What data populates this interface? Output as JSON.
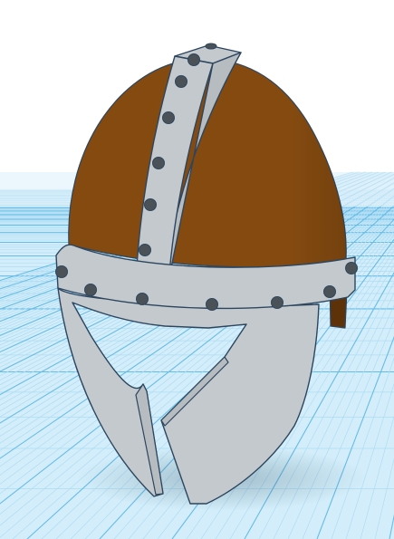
{
  "workspace": {
    "colors": {
      "background": "#ffffff",
      "grid_fill": "#d3eefa",
      "grid_minor": "#aedcf3",
      "grid_major": "#66bce8"
    }
  },
  "model": {
    "colors": {
      "dome": "#844a10",
      "dome_shadow": "#5e3209",
      "steel": "#c4c9cd",
      "steel_face": "#b7bcc1",
      "steel_edge": "#2d465f",
      "rivet": "#4a5258"
    }
  }
}
